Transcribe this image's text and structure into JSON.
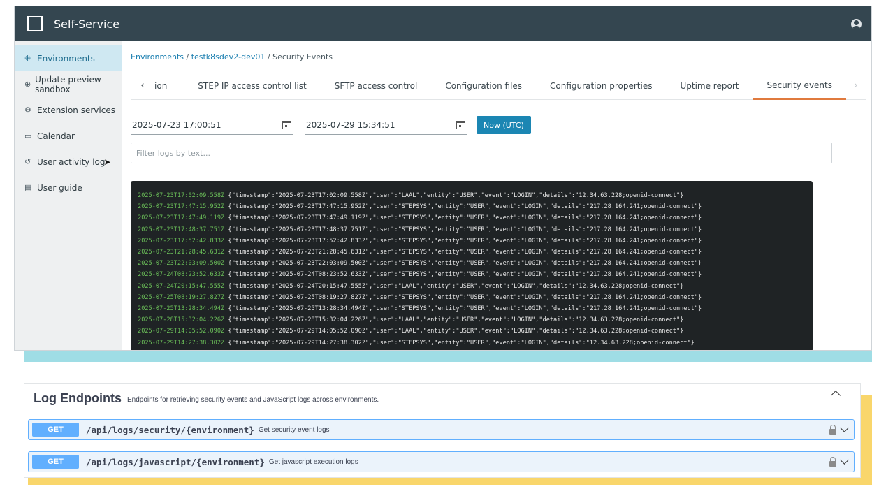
{
  "app": {
    "title": "Self-Service"
  },
  "sidebar": {
    "items": [
      {
        "label": "Environments",
        "icon": "environments-icon",
        "active": true
      },
      {
        "label": "Update preview sandbox",
        "icon": "sandbox-icon",
        "active": false
      },
      {
        "label": "Extension services",
        "icon": "extension-icon",
        "active": false
      },
      {
        "label": "Calendar",
        "icon": "calendar-icon",
        "active": false
      },
      {
        "label": "User activity log",
        "icon": "history-icon",
        "active": false
      },
      {
        "label": "User guide",
        "icon": "book-icon",
        "active": false
      }
    ]
  },
  "breadcrumb": {
    "root": "Environments",
    "sep1": " / ",
    "env": "testk8sdev2-dev01",
    "sep2": " / ",
    "current": "Security Events"
  },
  "tabs": [
    {
      "label": "ion",
      "active": false
    },
    {
      "label": "STEP IP access control list",
      "active": false
    },
    {
      "label": "SFTP access control",
      "active": false
    },
    {
      "label": "Configuration files",
      "active": false
    },
    {
      "label": "Configuration properties",
      "active": false
    },
    {
      "label": "Uptime report",
      "active": false
    },
    {
      "label": "Security events",
      "active": true
    }
  ],
  "filters": {
    "start_date": "2025-07-23 17:00:51",
    "end_date": "2025-07-29 15:34:51",
    "now_button": "Now (UTC)",
    "filter_placeholder": "Filter logs by text..."
  },
  "logs": [
    {
      "ts": "2025-07-23T17:02:09.558Z",
      "json": "{\"timestamp\":\"2025-07-23T17:02:09.558Z\",\"user\":\"LAAL\",\"entity\":\"USER\",\"event\":\"LOGIN\",\"details\":\"12.34.63.228;openid-connect\"}"
    },
    {
      "ts": "2025-07-23T17:47:15.952Z",
      "json": "{\"timestamp\":\"2025-07-23T17:47:15.952Z\",\"user\":\"STEPSYS\",\"entity\":\"USER\",\"event\":\"LOGIN\",\"details\":\"217.28.164.241;openid-connect\"}"
    },
    {
      "ts": "2025-07-23T17:47:49.119Z",
      "json": "{\"timestamp\":\"2025-07-23T17:47:49.119Z\",\"user\":\"STEPSYS\",\"entity\":\"USER\",\"event\":\"LOGIN\",\"details\":\"217.28.164.241;openid-connect\"}"
    },
    {
      "ts": "2025-07-23T17:48:37.751Z",
      "json": "{\"timestamp\":\"2025-07-23T17:48:37.751Z\",\"user\":\"STEPSYS\",\"entity\":\"USER\",\"event\":\"LOGIN\",\"details\":\"217.28.164.241;openid-connect\"}"
    },
    {
      "ts": "2025-07-23T17:52:42.833Z",
      "json": "{\"timestamp\":\"2025-07-23T17:52:42.833Z\",\"user\":\"STEPSYS\",\"entity\":\"USER\",\"event\":\"LOGIN\",\"details\":\"217.28.164.241;openid-connect\"}"
    },
    {
      "ts": "2025-07-23T21:28:45.631Z",
      "json": "{\"timestamp\":\"2025-07-23T21:28:45.631Z\",\"user\":\"STEPSYS\",\"entity\":\"USER\",\"event\":\"LOGIN\",\"details\":\"217.28.164.241;openid-connect\"}"
    },
    {
      "ts": "2025-07-23T22:03:09.500Z",
      "json": "{\"timestamp\":\"2025-07-23T22:03:09.500Z\",\"user\":\"STEPSYS\",\"entity\":\"USER\",\"event\":\"LOGIN\",\"details\":\"217.28.164.241;openid-connect\"}"
    },
    {
      "ts": "2025-07-24T08:23:52.633Z",
      "json": "{\"timestamp\":\"2025-07-24T08:23:52.633Z\",\"user\":\"STEPSYS\",\"entity\":\"USER\",\"event\":\"LOGIN\",\"details\":\"217.28.164.241;openid-connect\"}"
    },
    {
      "ts": "2025-07-24T20:15:47.555Z",
      "json": "{\"timestamp\":\"2025-07-24T20:15:47.555Z\",\"user\":\"LAAL\",\"entity\":\"USER\",\"event\":\"LOGIN\",\"details\":\"12.34.63.228;openid-connect\"}"
    },
    {
      "ts": "2025-07-25T08:19:27.827Z",
      "json": "{\"timestamp\":\"2025-07-25T08:19:27.827Z\",\"user\":\"STEPSYS\",\"entity\":\"USER\",\"event\":\"LOGIN\",\"details\":\"217.28.164.241;openid-connect\"}"
    },
    {
      "ts": "2025-07-25T13:28:34.494Z",
      "json": "{\"timestamp\":\"2025-07-25T13:28:34.494Z\",\"user\":\"STEPSYS\",\"entity\":\"USER\",\"event\":\"LOGIN\",\"details\":\"217.28.164.241;openid-connect\"}"
    },
    {
      "ts": "2025-07-28T15:32:04.226Z",
      "json": "{\"timestamp\":\"2025-07-28T15:32:04.226Z\",\"user\":\"LAAL\",\"entity\":\"USER\",\"event\":\"LOGIN\",\"details\":\"12.34.63.228;openid-connect\"}"
    },
    {
      "ts": "2025-07-29T14:05:52.090Z",
      "json": "{\"timestamp\":\"2025-07-29T14:05:52.090Z\",\"user\":\"LAAL\",\"entity\":\"USER\",\"event\":\"LOGIN\",\"details\":\"12.34.63.228;openid-connect\"}"
    },
    {
      "ts": "2025-07-29T14:27:38.302Z",
      "json": "{\"timestamp\":\"2025-07-29T14:27:38.302Z\",\"user\":\"STEPSYS\",\"entity\":\"USER\",\"event\":\"LOGIN\",\"details\":\"12.34.63.228;openid-connect\"}"
    }
  ],
  "swagger": {
    "title": "Log Endpoints",
    "description": "Endpoints for retrieving security events and JavaScript logs across environments.",
    "operations": [
      {
        "method": "GET",
        "path": "/api/logs/security/{environment}",
        "summary": "Get security event logs"
      },
      {
        "method": "GET",
        "path": "/api/logs/javascript/{environment}",
        "summary": "Get javascript execution logs"
      }
    ]
  },
  "colors": {
    "topbar": "#344650",
    "accent": "#1b86b3",
    "active_tab": "#e07a3e",
    "get_method": "#61affe"
  }
}
